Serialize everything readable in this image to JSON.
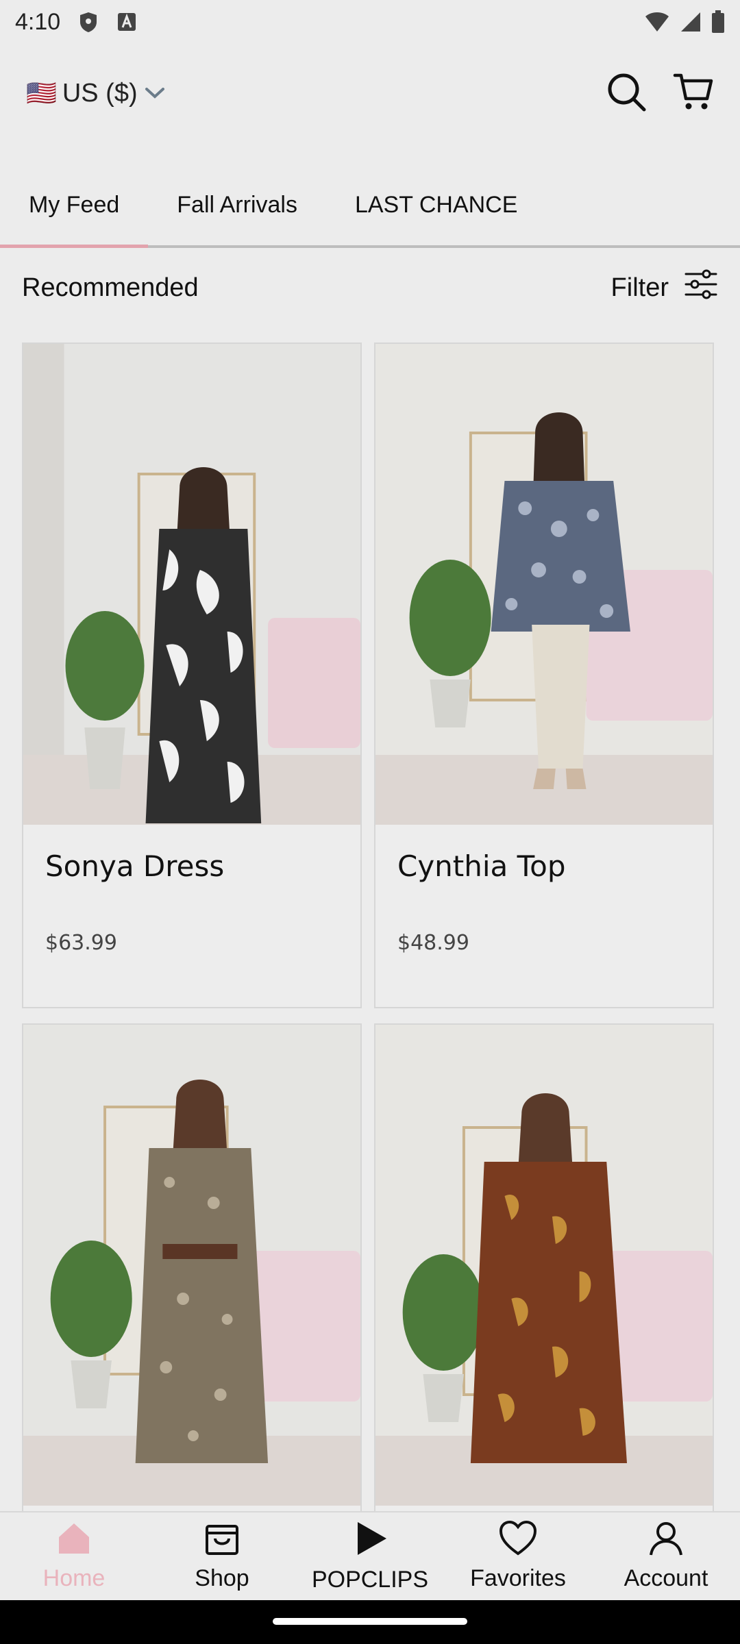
{
  "status": {
    "time": "4:10"
  },
  "header": {
    "flag": "🇺🇸",
    "currency": "US ($)"
  },
  "tabs": [
    {
      "label": "My Feed",
      "active": true
    },
    {
      "label": "Fall Arrivals",
      "active": false
    },
    {
      "label": "LAST CHANCE",
      "active": false
    }
  ],
  "section": {
    "title": "Recommended",
    "filter_label": "Filter"
  },
  "products": [
    {
      "title": "Sonya Dress",
      "price": "$63.99"
    },
    {
      "title": "Cynthia Top",
      "price": "$48.99"
    },
    {
      "title": "",
      "price": ""
    },
    {
      "title": "",
      "price": ""
    }
  ],
  "nav": [
    {
      "label": "Home",
      "icon": "home-icon",
      "active": true
    },
    {
      "label": "Shop",
      "icon": "shop-icon",
      "active": false
    },
    {
      "label": "POPCLIPS",
      "icon": "play-icon",
      "active": false
    },
    {
      "label": "Favorites",
      "icon": "heart-icon",
      "active": false
    },
    {
      "label": "Account",
      "icon": "account-icon",
      "active": false
    }
  ],
  "colors": {
    "accent": "#e9b3bc",
    "background": "#ececec"
  }
}
